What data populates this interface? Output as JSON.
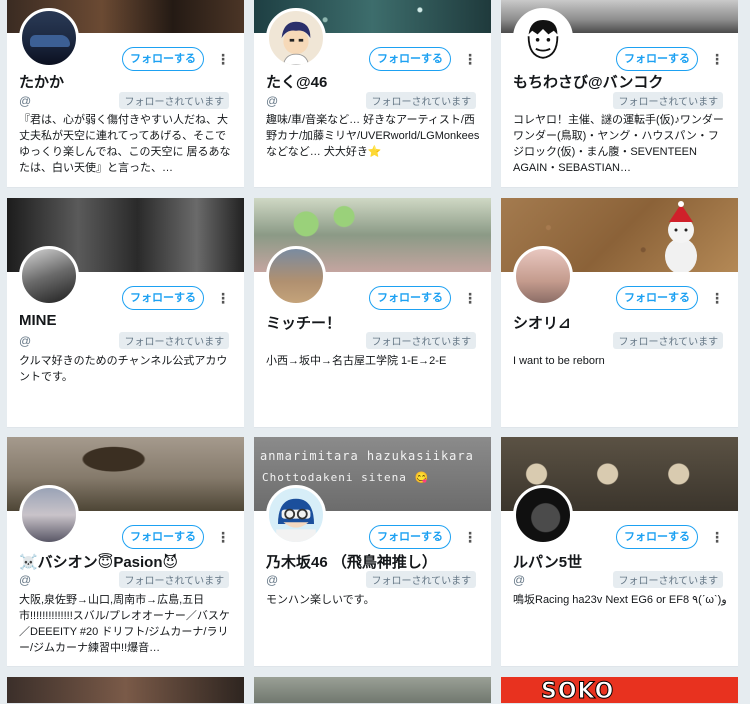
{
  "follow_label": "フォローする",
  "follows_you_label": "フォローされています",
  "cards": [
    {
      "name": "たかか",
      "handle": "@",
      "bio": "『君は、心が弱く傷付きやすい人だね、大丈夫私が天空に連れてってあげる、そこでゆっくり楽しんでね、この天空に 居るあなたは、白い天使』と言った、…",
      "avatar": "car-avatar",
      "banner": "dark-photo-banner"
    },
    {
      "name": "たく@46",
      "handle": "@",
      "bio": "趣味/車/音楽など… 好きなアーティスト/西野カナ/加藤ミリヤ/UVERworld/LGMonkeesなどなど… 犬大好き⭐",
      "avatar": "anime-boy-avatar",
      "banner": "sparkle-banner"
    },
    {
      "name": "もちわさび@バンコク",
      "handle": "",
      "bio": "コレヤロ！主催、謎の運転手(仮)♪ワンダーワンダー(鳥取)・ヤング・ハウスパン・フジロック(仮)・まん腹・SEVENTEEN AGAIN・SEBASTIAN…",
      "avatar": "face-drawing-avatar",
      "banner": "street-banner"
    },
    {
      "name": "MINE",
      "handle": "@",
      "bio": "クルマ好きのためのチャンネル公式アカウントです。",
      "avatar": "guitar-avatar",
      "banner": "band-banner"
    },
    {
      "name": "ミッチー！",
      "handle": "",
      "bio": "小西→坂中→名古屋工学院 1-E→2-E",
      "avatar": "group-photo-avatar",
      "banner": "aliens-banner"
    },
    {
      "name": "シオリ⊿",
      "handle": "",
      "bio": "I want to be reborn",
      "avatar": "girl-avatar",
      "banner": "cork-banner"
    },
    {
      "name": "☠️バシオン😇Pasion😈",
      "handle": "@",
      "bio": "大阪,泉佐野→山口,周南市→広島,五日市!!!!!!!!!!!!!!スバル/プレオオーナー／バスケ／DEEEITY #20 ドリフト/ジムカーナ/ラリー/ジムカーナ練習中!!爆音…",
      "avatar": "sunset-avatar",
      "banner": "tree-banner"
    },
    {
      "name": "乃木坂46 （飛鳥神推し）",
      "handle": "@",
      "bio": "モンハン楽しいです。",
      "avatar": "doraemon-avatar",
      "banner": "chalkboard-banner",
      "banner_text_1": "anmarimitara hazukasiikara",
      "banner_text_2": "Chottodakeni sitena 😋"
    },
    {
      "name": "ルパン5世",
      "handle": "@",
      "bio": "鳴坂Racing ha23v Next EG6 or EF8 ٩(ˊωˋ)و",
      "avatar": "black-avatar",
      "banner": "plush-toys-banner"
    }
  ],
  "partial_row": {
    "banners": [
      "dance-banner",
      "office-banner",
      "red-logo-banner"
    ],
    "logo_text": "SOKO"
  },
  "colors": {
    "background": "#e6ecf0",
    "accent": "#1da1f2",
    "text": "#14171a",
    "muted": "#657786"
  }
}
